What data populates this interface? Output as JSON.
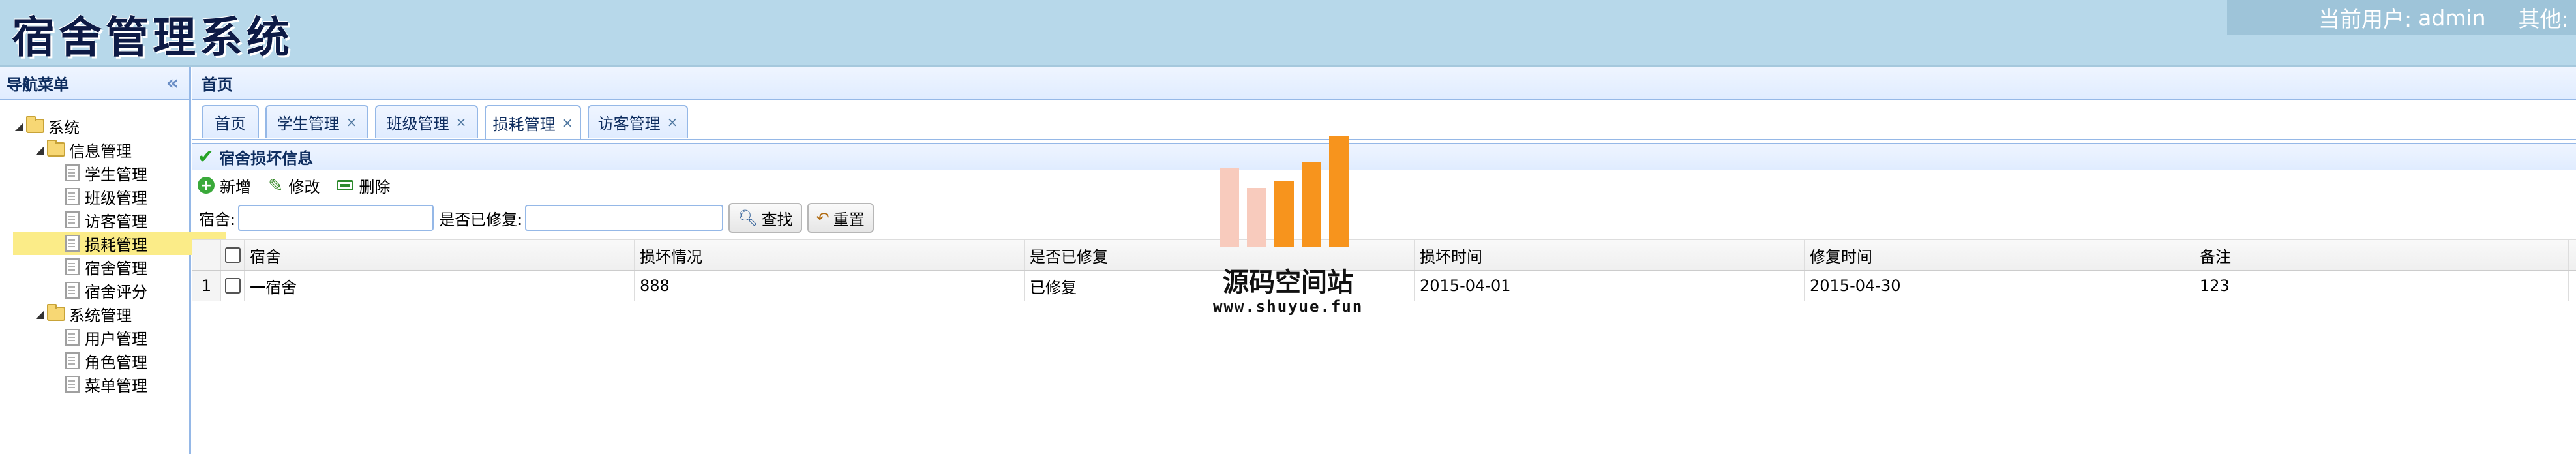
{
  "header": {
    "app_title": "宿舍管理系统",
    "current_user_label": "当前用户:",
    "current_user": "admin",
    "other_label": "其他:"
  },
  "sidebar": {
    "title": "导航菜单",
    "tree": [
      {
        "label": "系统",
        "type": "folder",
        "level": 0
      },
      {
        "label": "信息管理",
        "type": "folder",
        "level": 1
      },
      {
        "label": "学生管理",
        "type": "file",
        "level": 2
      },
      {
        "label": "班级管理",
        "type": "file",
        "level": 2
      },
      {
        "label": "访客管理",
        "type": "file",
        "level": 2
      },
      {
        "label": "损耗管理",
        "type": "file",
        "level": 2,
        "selected": true
      },
      {
        "label": "宿舍管理",
        "type": "file",
        "level": 2
      },
      {
        "label": "宿舍评分",
        "type": "file",
        "level": 2
      },
      {
        "label": "系统管理",
        "type": "folder",
        "level": 1
      },
      {
        "label": "用户管理",
        "type": "file",
        "level": 2
      },
      {
        "label": "角色管理",
        "type": "file",
        "level": 2
      },
      {
        "label": "菜单管理",
        "type": "file",
        "level": 2
      }
    ]
  },
  "main": {
    "breadcrumb": "首页",
    "tabs": [
      {
        "label": "首页",
        "closable": false
      },
      {
        "label": "学生管理",
        "closable": true
      },
      {
        "label": "班级管理",
        "closable": true
      },
      {
        "label": "损耗管理",
        "closable": true,
        "active": true
      },
      {
        "label": "访客管理",
        "closable": true
      }
    ],
    "close_glyph": "×",
    "panel_title": "宿舍损坏信息",
    "toolbar": {
      "add": "新增",
      "edit": "修改",
      "delete": "删除"
    },
    "search": {
      "dorm_label": "宿舍:",
      "dorm_value": "",
      "repaired_label": "是否已修复:",
      "repaired_value": "",
      "find_button": "查找",
      "reset_button": "重置"
    },
    "grid": {
      "columns": [
        "宿舍",
        "损坏情况",
        "是否已修复",
        "损坏时间",
        "修复时间",
        "备注"
      ],
      "rows": [
        {
          "num": "1",
          "cells": [
            "一宿舍",
            "888",
            "已修复",
            "2015-04-01",
            "2015-04-30",
            "123"
          ]
        }
      ]
    }
  },
  "watermark": {
    "text": "源码空间站",
    "url": "www.shuyue.fun"
  }
}
